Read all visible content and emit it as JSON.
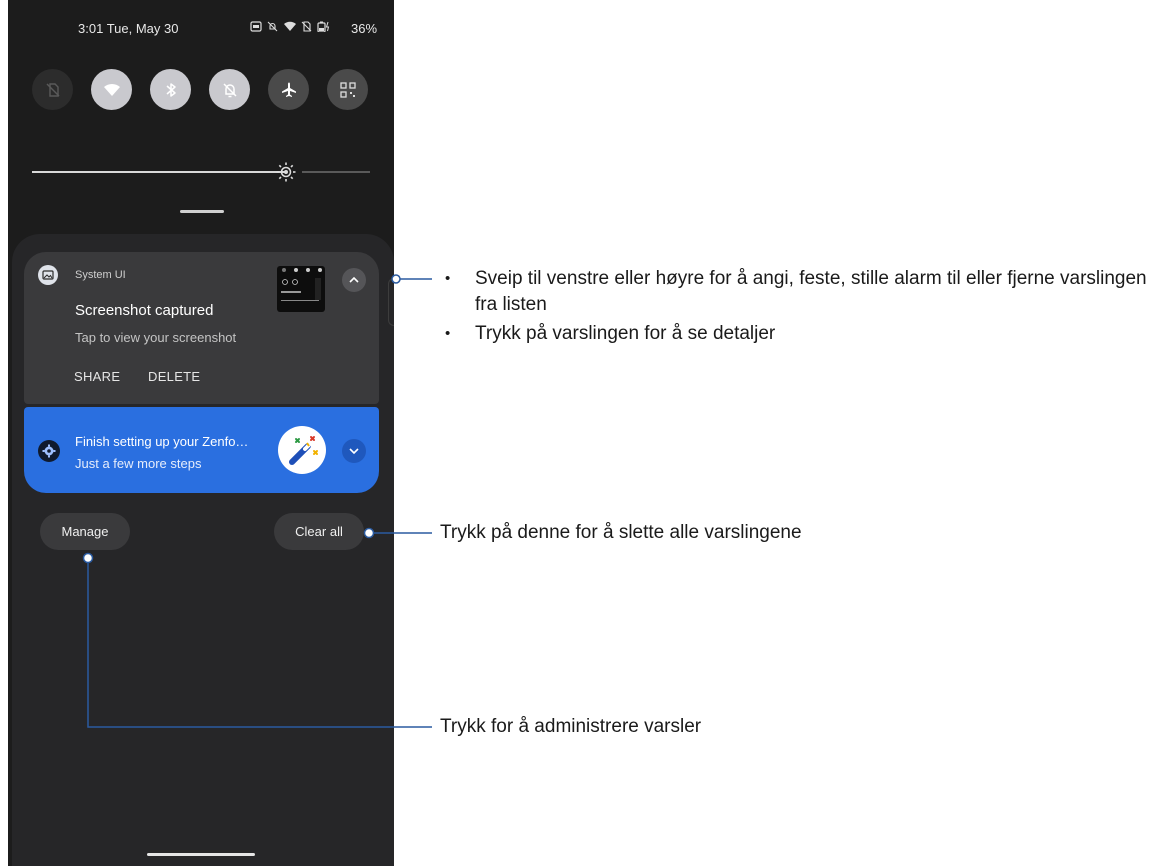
{
  "status_bar": {
    "time": "3:01",
    "date": "Tue, May 30",
    "battery_percent": "36%"
  },
  "quick_settings": [
    {
      "name": "sim-off",
      "icon": "sim-card-off-icon",
      "state": "off"
    },
    {
      "name": "wifi",
      "icon": "wifi-icon",
      "state": "on"
    },
    {
      "name": "bluetooth",
      "icon": "bluetooth-icon",
      "state": "on"
    },
    {
      "name": "do-not-disturb",
      "icon": "bell-off-icon",
      "state": "on"
    },
    {
      "name": "airplane-mode",
      "icon": "airplane-icon",
      "state": "dim"
    },
    {
      "name": "qr-scanner",
      "icon": "qr-code-icon",
      "state": "dim"
    }
  ],
  "brightness_level": 0.77,
  "notifications": [
    {
      "app": "System UI",
      "title": "Screenshot captured",
      "text": "Tap to view your screenshot",
      "actions": [
        "SHARE",
        "DELETE"
      ],
      "expanded": true
    },
    {
      "title": "Finish setting up your Zenfo…",
      "text": "Just a few more steps",
      "accent": "#2a6fe0",
      "expanded": false
    }
  ],
  "buttons": {
    "manage": "Manage",
    "clear_all": "Clear all"
  },
  "annotations": {
    "swipe_bullets": [
      "Sveip til venstre eller høyre for å angi, feste, stille alarm til eller fjerne varslingen fra listen",
      "Trykk på varslingen for å se detaljer"
    ],
    "clear_all": "Trykk på denne for å slette alle varslingene",
    "manage": "Trykk for å administrere varsler"
  },
  "colors": {
    "phone_bg": "#1c1c1c",
    "shade_bg": "#262628",
    "card_bg": "#3a3a3c",
    "accent_blue": "#2a6fe0",
    "callout_line": "#2a5aa0"
  }
}
